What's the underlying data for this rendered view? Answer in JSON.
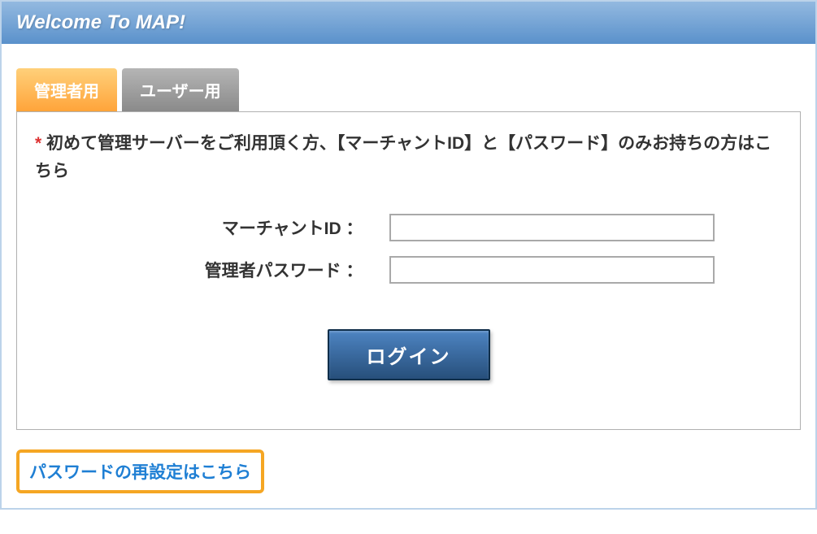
{
  "header": {
    "title": "Welcome To MAP!"
  },
  "tabs": {
    "admin": "管理者用",
    "user": "ユーザー用"
  },
  "notice": {
    "asterisk": "*",
    "text": "初めて管理サーバーをご利用頂く方、【マーチャントID】と【パスワード】のみお持ちの方はこちら"
  },
  "form": {
    "merchant_id_label": "マーチャントID ：",
    "admin_password_label": "管理者パスワード ：",
    "merchant_id_value": "",
    "admin_password_value": ""
  },
  "buttons": {
    "login": "ログイン"
  },
  "links": {
    "password_reset": "パスワードの再設定はこちら"
  }
}
